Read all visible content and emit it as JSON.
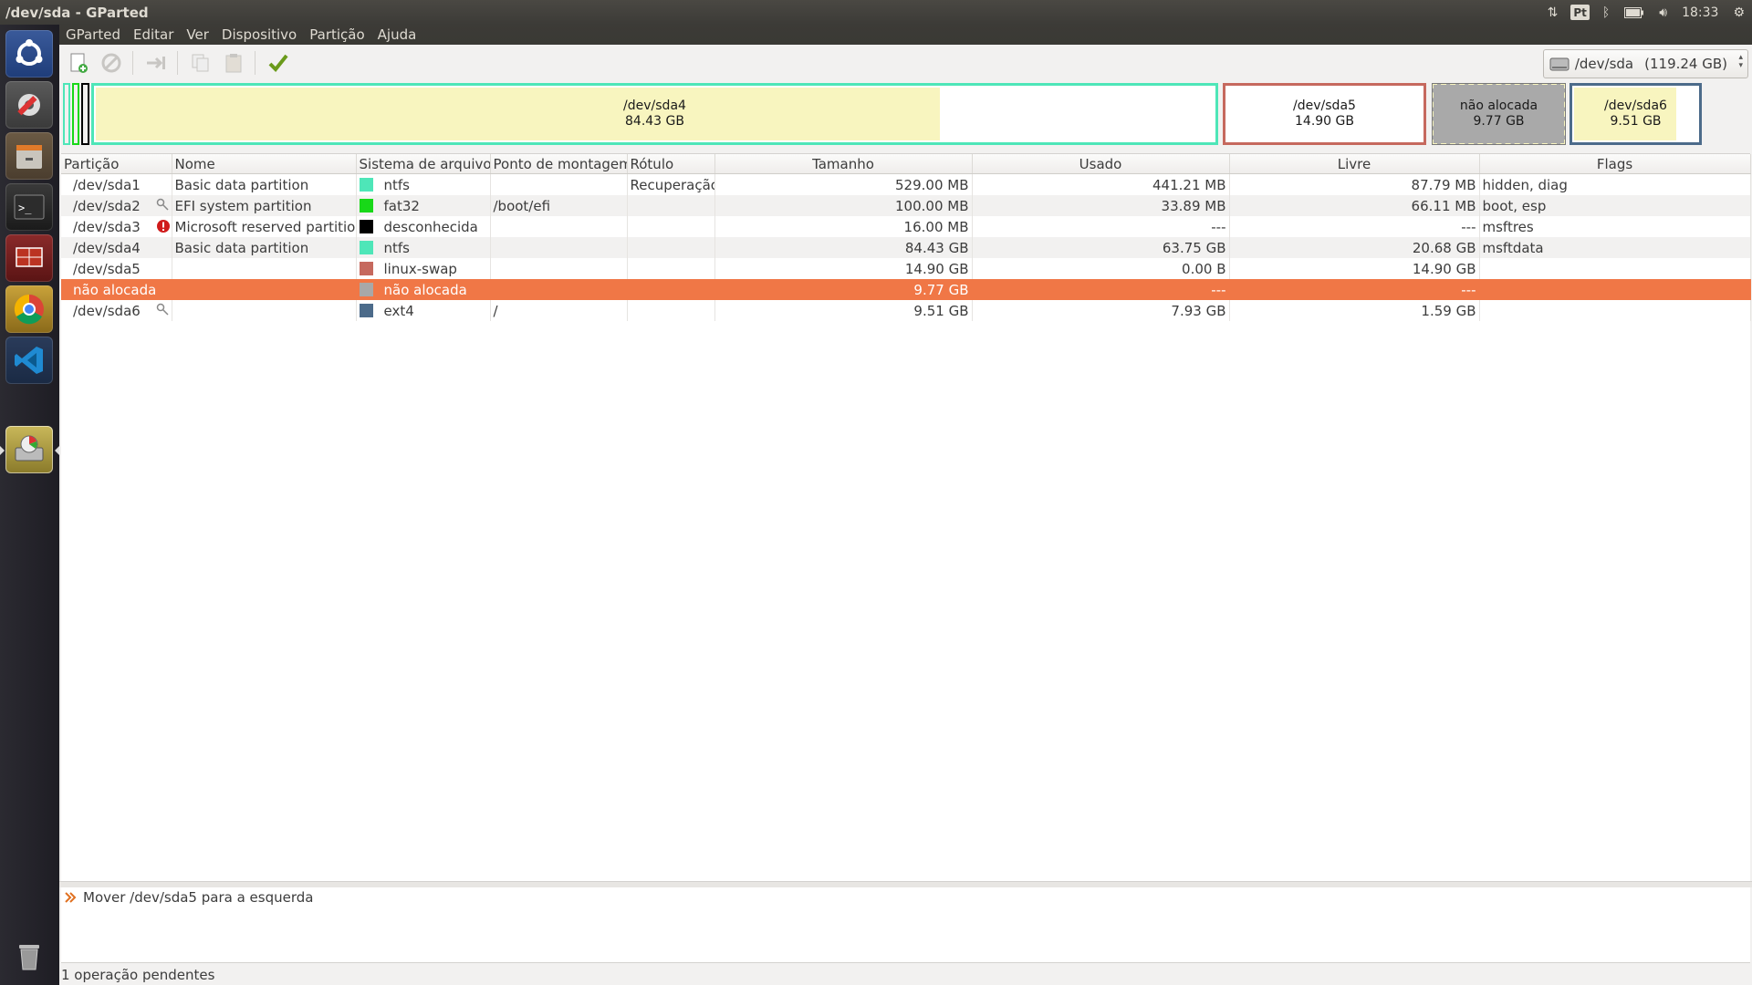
{
  "window_title": "/dev/sda - GParted",
  "tray": {
    "lang": "Pt",
    "time": "18:33"
  },
  "menu": [
    "GParted",
    "Editar",
    "Ver",
    "Dispositivo",
    "Partição",
    "Ajuda"
  ],
  "device": {
    "name": "/dev/sda",
    "size": "(119.24 GB)"
  },
  "diskmap": [
    {
      "name": "/dev/sda4",
      "size": "84.43 GB",
      "used_fraction": 0.755
    },
    {
      "name": "/dev/sda5",
      "size": "14.90 GB"
    },
    {
      "name": "não alocada",
      "size": "9.77 GB"
    },
    {
      "name": "/dev/sda6",
      "size": "9.51 GB",
      "used_fraction": 0.83
    }
  ],
  "columns": [
    "Partição",
    "Nome",
    "Sistema de arquivos",
    "Ponto de montagem",
    "Rótulo",
    "Tamanho",
    "Usado",
    "Livre",
    "Flags"
  ],
  "rows": [
    {
      "part": "/dev/sda1",
      "name": "Basic data partition",
      "fs": "ntfs",
      "fs_color": "#4ee6b8",
      "mount": "",
      "label": "Recuperação",
      "size": "529.00 MB",
      "used": "441.21 MB",
      "free": "87.79 MB",
      "flags": "hidden, diag",
      "icon": ""
    },
    {
      "part": "/dev/sda2",
      "name": "EFI system partition",
      "fs": "fat32",
      "fs_color": "#18d818",
      "mount": "/boot/efi",
      "label": "",
      "size": "100.00 MB",
      "used": "33.89 MB",
      "free": "66.11 MB",
      "flags": "boot, esp",
      "icon": "key-icon"
    },
    {
      "part": "/dev/sda3",
      "name": "Microsoft reserved partition",
      "fs": "desconhecida",
      "fs_color": "#000000",
      "mount": "",
      "label": "",
      "size": "16.00 MB",
      "used": "---",
      "free": "---",
      "flags": "msftres",
      "icon": "error-icon"
    },
    {
      "part": "/dev/sda4",
      "name": "Basic data partition",
      "fs": "ntfs",
      "fs_color": "#4ee6b8",
      "mount": "",
      "label": "",
      "size": "84.43 GB",
      "used": "63.75 GB",
      "free": "20.68 GB",
      "flags": "msftdata",
      "icon": ""
    },
    {
      "part": "/dev/sda5",
      "name": "",
      "fs": "linux-swap",
      "fs_color": "#c6695e",
      "mount": "",
      "label": "",
      "size": "14.90 GB",
      "used": "0.00 B",
      "free": "14.90 GB",
      "flags": "",
      "icon": ""
    },
    {
      "part": "não alocada",
      "name": "",
      "fs": "não alocada",
      "fs_color": "#a8a8a8",
      "mount": "",
      "label": "",
      "size": "9.77 GB",
      "used": "---",
      "free": "---",
      "flags": "",
      "icon": "",
      "selected": true
    },
    {
      "part": "/dev/sda6",
      "name": "",
      "fs": "ext4",
      "fs_color": "#4c6b8a",
      "mount": "/",
      "label": "",
      "size": "9.51 GB",
      "used": "7.93 GB",
      "free": "1.59 GB",
      "flags": "",
      "icon": "key-icon"
    }
  ],
  "operations": [
    "Mover /dev/sda5 para a esquerda"
  ],
  "status": "1 operação pendentes"
}
